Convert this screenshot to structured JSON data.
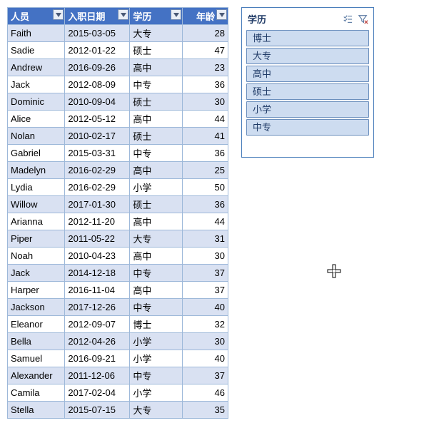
{
  "table": {
    "headers": [
      "人员",
      "入职日期",
      "学历",
      "年龄"
    ],
    "rows": [
      {
        "name": "Faith",
        "date": "2015-03-05",
        "edu": "大专",
        "age": 28
      },
      {
        "name": "Sadie",
        "date": "2012-01-22",
        "edu": "硕士",
        "age": 47
      },
      {
        "name": "Andrew",
        "date": "2016-09-26",
        "edu": "高中",
        "age": 23
      },
      {
        "name": "Jack",
        "date": "2012-08-09",
        "edu": "中专",
        "age": 36
      },
      {
        "name": "Dominic",
        "date": "2010-09-04",
        "edu": "硕士",
        "age": 30
      },
      {
        "name": "Alice",
        "date": "2012-05-12",
        "edu": "高中",
        "age": 44
      },
      {
        "name": "Nolan",
        "date": "2010-02-17",
        "edu": "硕士",
        "age": 41
      },
      {
        "name": "Gabriel",
        "date": "2015-03-31",
        "edu": "中专",
        "age": 36
      },
      {
        "name": "Madelyn",
        "date": "2016-02-29",
        "edu": "高中",
        "age": 25
      },
      {
        "name": "Lydia",
        "date": "2016-02-29",
        "edu": "小学",
        "age": 50
      },
      {
        "name": "Willow",
        "date": "2017-01-30",
        "edu": "硕士",
        "age": 36
      },
      {
        "name": "Arianna",
        "date": "2012-11-20",
        "edu": "高中",
        "age": 44
      },
      {
        "name": "Piper",
        "date": "2011-05-22",
        "edu": "大专",
        "age": 31
      },
      {
        "name": "Noah",
        "date": "2010-04-23",
        "edu": "高中",
        "age": 30
      },
      {
        "name": "Jack",
        "date": "2014-12-18",
        "edu": "中专",
        "age": 37
      },
      {
        "name": "Harper",
        "date": "2016-11-04",
        "edu": "高中",
        "age": 37
      },
      {
        "name": "Jackson",
        "date": "2017-12-26",
        "edu": "中专",
        "age": 40
      },
      {
        "name": "Eleanor",
        "date": "2012-09-07",
        "edu": "博士",
        "age": 32
      },
      {
        "name": "Bella",
        "date": "2012-04-26",
        "edu": "小学",
        "age": 30
      },
      {
        "name": "Samuel",
        "date": "2016-09-21",
        "edu": "小学",
        "age": 40
      },
      {
        "name": "Alexander",
        "date": "2011-12-06",
        "edu": "中专",
        "age": 37
      },
      {
        "name": "Camila",
        "date": "2017-02-04",
        "edu": "小学",
        "age": 46
      },
      {
        "name": "Stella",
        "date": "2015-07-15",
        "edu": "大专",
        "age": 35
      }
    ]
  },
  "slicer": {
    "title": "学历",
    "items": [
      "博士",
      "大专",
      "高中",
      "硕士",
      "小学",
      "中专"
    ]
  }
}
